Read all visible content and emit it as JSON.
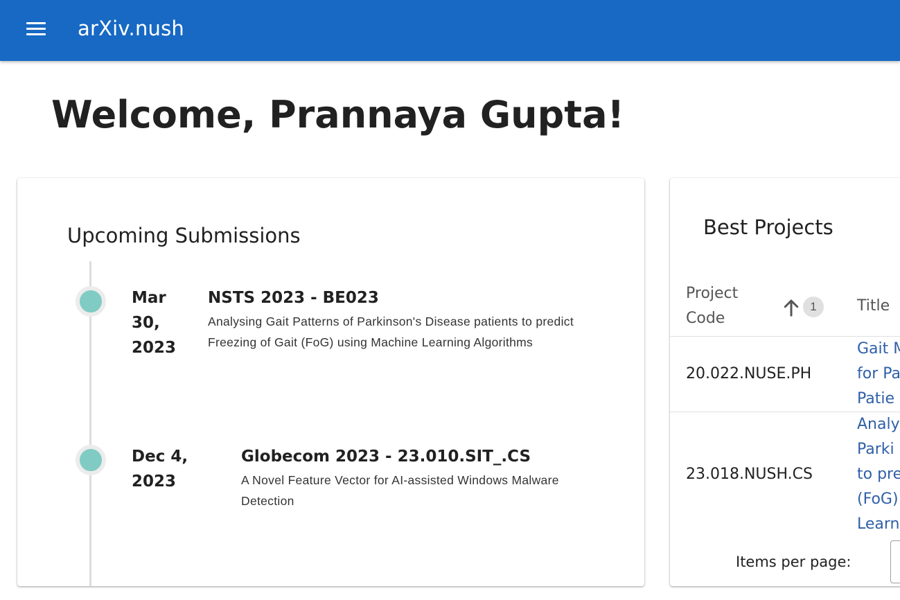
{
  "app": {
    "title": "arXiv.nush",
    "menu_icon": "menu-icon"
  },
  "colors": {
    "appbar": "#1769c4",
    "timeline_dot": "#80cbc4",
    "link": "#2f5fa8"
  },
  "welcome": {
    "text": "Welcome, Prannaya Gupta!"
  },
  "upcoming": {
    "title": "Upcoming Submissions",
    "items": [
      {
        "date_line1": "Mar",
        "date_line2": "30,",
        "date_line3": "2023",
        "title": "NSTS 2023 - BE023",
        "desc_line1": "Analysing Gait Patterns of Parkinson's Disease patients to predict",
        "desc_line2": "Freezing of Gait (FoG) using Machine Learning Algorithms"
      },
      {
        "date_line1": "Dec 4,",
        "date_line2": "2023",
        "title": "Globecom 2023 - 23.010.SIT_.CS",
        "desc_line1": "A Novel Feature Vector for AI-assisted Windows Malware",
        "desc_line2": "Detection"
      }
    ]
  },
  "best": {
    "title": "Best Projects",
    "header_code_line1": "Project",
    "header_code_line2": "Code",
    "sort_badge": "1",
    "sort_icon": "arrow-up-icon",
    "header_title": "Title",
    "rows": [
      {
        "code": "20.022.NUSE.PH",
        "title_lines": [
          "Gait M",
          "for Pa",
          "Patie"
        ]
      },
      {
        "code": "23.018.NUSH.CS",
        "title_lines": [
          "Analy",
          "Parki",
          "to pre",
          "(FoG)",
          "Learn"
        ]
      }
    ],
    "items_per_page_label": "Items per page:"
  }
}
